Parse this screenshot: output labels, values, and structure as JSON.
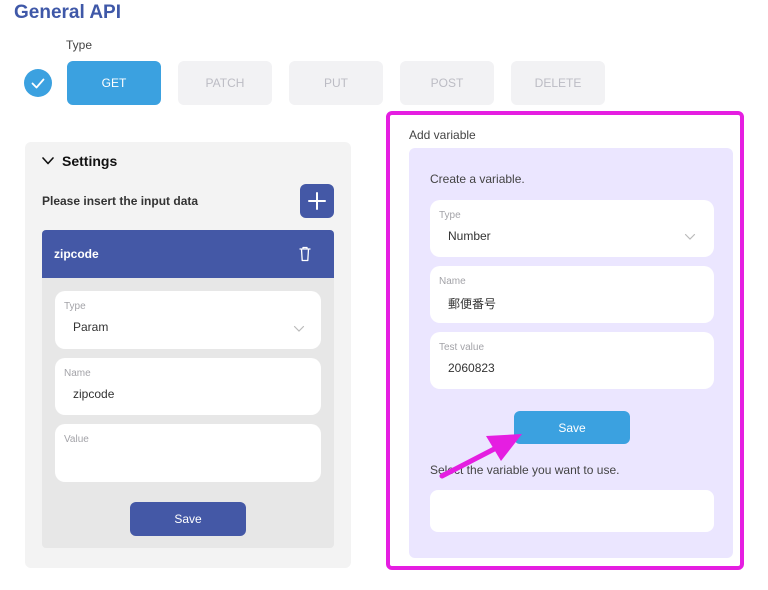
{
  "header": {
    "title": "General API",
    "type_label": "Type",
    "methods": [
      {
        "label": "GET",
        "active": true
      },
      {
        "label": "PATCH",
        "active": false
      },
      {
        "label": "PUT",
        "active": false
      },
      {
        "label": "POST",
        "active": false
      },
      {
        "label": "DELETE",
        "active": false
      }
    ]
  },
  "settings": {
    "title": "Settings",
    "insert_label": "Please insert the input data",
    "card": {
      "title": "zipcode",
      "type": {
        "label": "Type",
        "value": "Param"
      },
      "name": {
        "label": "Name",
        "value": "zipcode"
      },
      "value": {
        "label": "Value",
        "value": ""
      },
      "save_label": "Save"
    }
  },
  "add_variable": {
    "label": "Add variable",
    "create_label": "Create a variable.",
    "type": {
      "label": "Type",
      "value": "Number"
    },
    "name": {
      "label": "Name",
      "value": "郵便番号"
    },
    "test_value": {
      "label": "Test value",
      "value": "2060823"
    },
    "save_label": "Save",
    "select_label": "Select the variable you want to use.",
    "select_value": ""
  },
  "colors": {
    "accent": "#3ba1e0",
    "primary": "#4458a6",
    "highlight": "#e51ee1",
    "panel_purple": "#ebe6ff"
  },
  "icons": {
    "check": "check-circle-icon",
    "chevron": "chevron-down-icon",
    "plus": "plus-icon",
    "trash": "trash-icon",
    "arrow": "arrow-annotation-icon"
  }
}
